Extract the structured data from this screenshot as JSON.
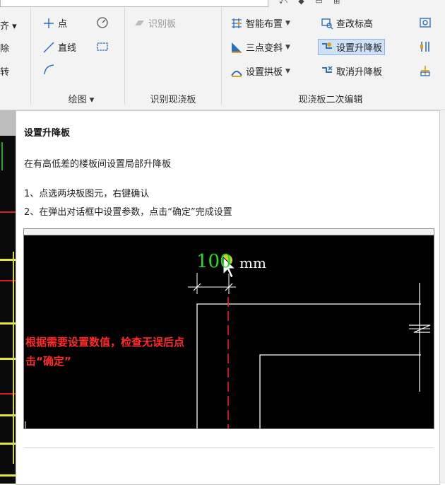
{
  "ribbon": {
    "left_cut": [
      "齐 ▾",
      "除",
      "转"
    ],
    "draw": {
      "point": "点",
      "line": "直线",
      "group_label": "绘图 ▾"
    },
    "identify": {
      "button": "识别板",
      "group_label": "识别现浇板"
    },
    "edit": {
      "smart_layout": "智能布置",
      "three_point_slope": "三点变斜",
      "set_arch": "设置拱板",
      "check_elevation": "查改标高",
      "set_raise_lower": "设置升降板",
      "cancel_raise_lower": "取消升降板",
      "group_label": "现浇板二次编辑"
    }
  },
  "tooltip": {
    "title": "设置升降板",
    "description": "在有高低差的楼板间设置局部升降板",
    "steps": [
      "1、点选两块板图元，右键确认",
      "2、在弹出对话框中设置参数，点击“确定”完成设置"
    ],
    "demo": {
      "dimension_value": "100",
      "unit": "mm",
      "note": "根据需要设置数值，检查无误后点击“确定”"
    }
  },
  "colors": {
    "accent_blue": "#2b6fc4",
    "note_red": "#ff2a2a",
    "dimension_green": "#22dd22"
  }
}
